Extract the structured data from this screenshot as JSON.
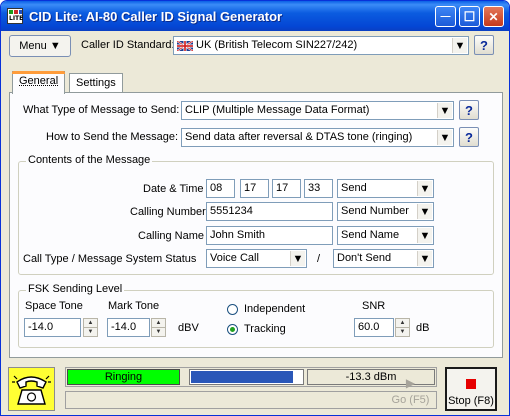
{
  "window": {
    "title": "CID Lite:  AI-80 Caller ID Signal Generator",
    "app_icon_text": "LITE",
    "minimize_glyph": "—",
    "maximize_glyph": "☐",
    "close_glyph": "✕"
  },
  "toolbar": {
    "menu_label": "Menu ▼",
    "standard_label": "Caller ID Standard:",
    "standard_value": "UK (British Telecom SIN227/242)",
    "help_glyph": "?"
  },
  "tabs": [
    {
      "label": "General",
      "active": true
    },
    {
      "label": "Settings",
      "active": false
    }
  ],
  "general": {
    "message_type_label": "What Type of Message to Send:",
    "message_type_value": "CLIP (Multiple Message Data Format)",
    "send_method_label": "How to Send the Message:",
    "send_method_value": "Send data after reversal & DTAS tone (ringing)",
    "contents_title": "Contents of the Message",
    "datetime_label": "Date & Time",
    "month": "08",
    "day": "17",
    "hour": "17",
    "minute": "33",
    "datetime_option": "Send",
    "calling_number_label": "Calling Number",
    "calling_number": "5551234",
    "calling_number_option": "Send Number",
    "calling_name_label": "Calling Name",
    "calling_name": "John Smith",
    "calling_name_option": "Send Name",
    "call_type_label": "Call Type / Message System Status",
    "call_type_value": "Voice Call",
    "call_type_separator": "/",
    "status_option": "Don't Send"
  },
  "fsk": {
    "title": "FSK Sending Level",
    "space_tone_label": "Space Tone",
    "space_tone_value": "-14.0",
    "mark_tone_label": "Mark Tone",
    "mark_tone_value": "-14.0",
    "unit_dbv": "dBV",
    "independent_label": "Independent",
    "tracking_label": "Tracking",
    "selected_mode": "Tracking",
    "snr_label": "SNR",
    "snr_value": "60.0",
    "unit_db": "dB"
  },
  "status": {
    "ringing_label": "Ringing",
    "level_fill": 0.92,
    "level_text": "-13.3 dBm",
    "go_label": "Go (F5)",
    "stop_label": "Stop (F8)",
    "colors": {
      "ringing": "#00ff00",
      "level_bar": "#2a57b8",
      "stop_square": "#e60000"
    }
  }
}
